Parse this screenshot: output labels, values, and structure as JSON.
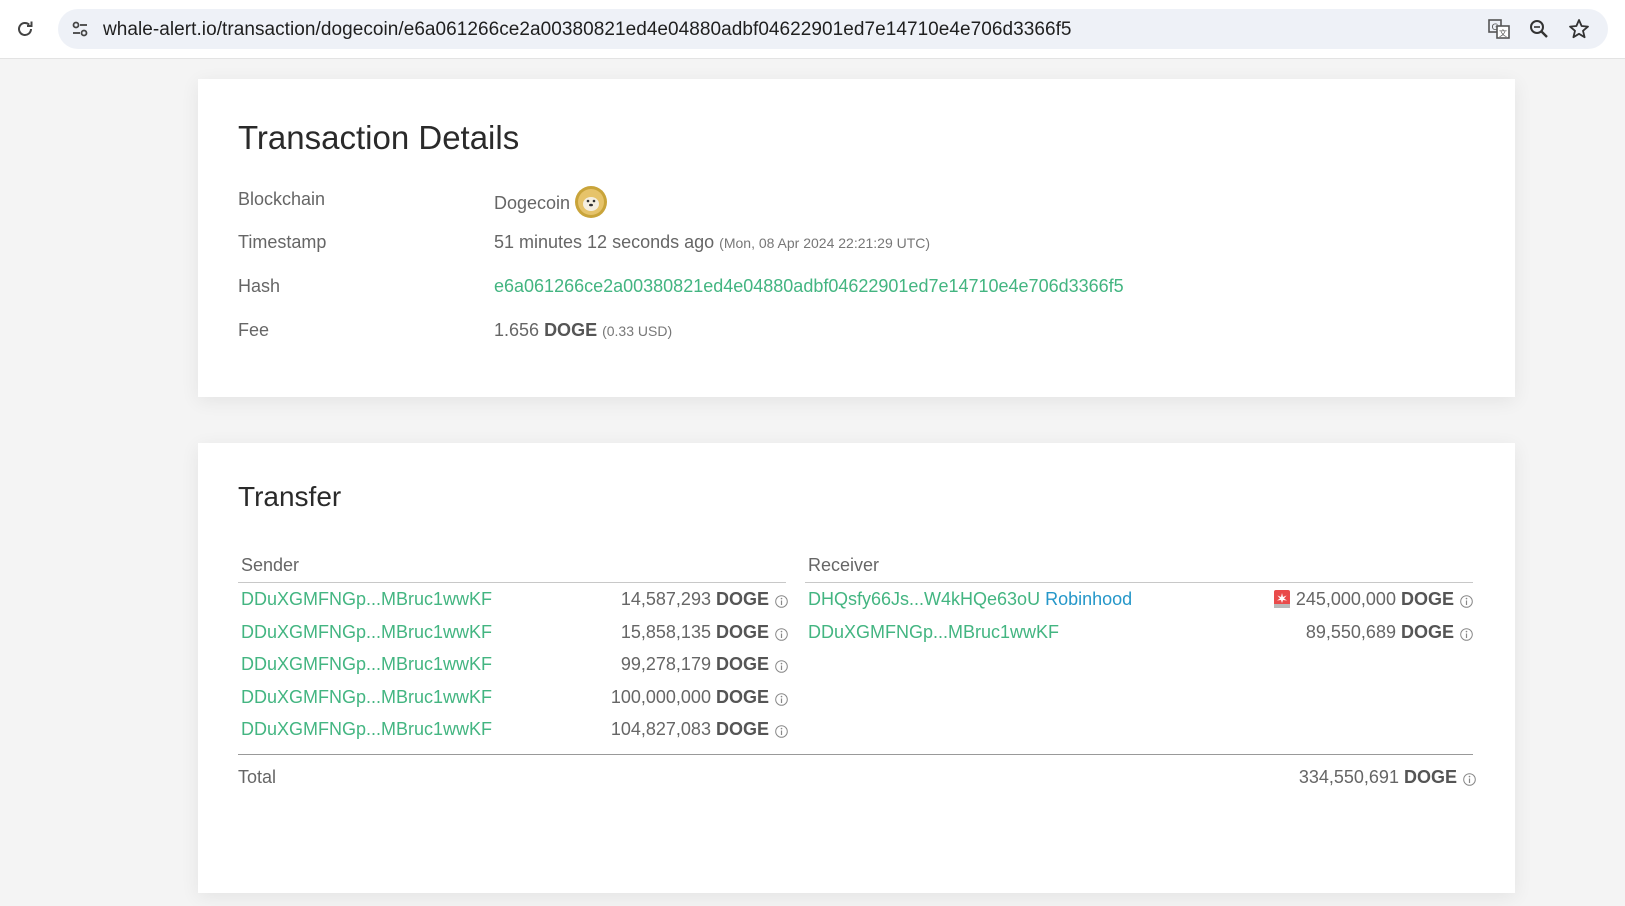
{
  "browser": {
    "url": "whale-alert.io/transaction/dogecoin/e6a061266ce2a00380821ed4e04880adbf04622901ed7e14710e4e706d3366f5",
    "icons": [
      "reload-icon",
      "site-info-icon",
      "translate-icon",
      "zoom-icon",
      "bookmark-star-icon"
    ]
  },
  "details": {
    "title": "Transaction Details",
    "blockchain_label": "Blockchain",
    "blockchain_value": "Dogecoin",
    "timestamp_label": "Timestamp",
    "timestamp_relative": "51 minutes 12 seconds ago",
    "timestamp_absolute": "(Mon, 08 Apr 2024 22:21:29 UTC)",
    "hash_label": "Hash",
    "hash_value": "e6a061266ce2a00380821ed4e04880adbf04622901ed7e14710e4e706d3366f5",
    "fee_label": "Fee",
    "fee_amount": "1.656",
    "fee_unit": "DOGE",
    "fee_usd": "(0.33 USD)"
  },
  "transfer": {
    "title": "Transfer",
    "sender_header": "Sender",
    "receiver_header": "Receiver",
    "unit": "DOGE",
    "senders": [
      {
        "address": "DDuXGMFNGp...MBruc1wwKF",
        "amount": "14,587,293"
      },
      {
        "address": "DDuXGMFNGp...MBruc1wwKF",
        "amount": "15,858,135"
      },
      {
        "address": "DDuXGMFNGp...MBruc1wwKF",
        "amount": "99,278,179"
      },
      {
        "address": "DDuXGMFNGp...MBruc1wwKF",
        "amount": "100,000,000"
      },
      {
        "address": "DDuXGMFNGp...MBruc1wwKF",
        "amount": "104,827,083"
      }
    ],
    "receivers": [
      {
        "address": "DHQsfy66Js...W4kHQe63oU",
        "tag": "Robinhood",
        "amount": "245,000,000",
        "alert": true
      },
      {
        "address": "DDuXGMFNGp...MBruc1wwKF",
        "tag": "",
        "amount": "89,550,689",
        "alert": false
      }
    ],
    "total_label": "Total",
    "total_amount": "334,550,691"
  },
  "colors": {
    "link_green": "#43b581",
    "tag_blue": "#2597c9",
    "background": "#f4f4f4",
    "card": "#ffffff"
  }
}
